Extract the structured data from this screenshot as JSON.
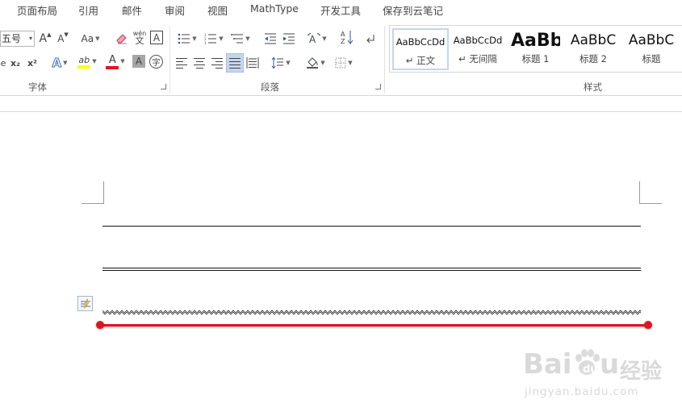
{
  "tabs": [
    "页面布局",
    "引用",
    "邮件",
    "审阅",
    "视图",
    "MathType",
    "开发工具",
    "保存到云笔记"
  ],
  "ribbon": {
    "font_group": {
      "label": "字体",
      "font_size": "五号",
      "grow_font": "A",
      "shrink_font": "A",
      "change_case": "Aa",
      "phonetic_top": "wén",
      "phonetic_bottom": "文",
      "border_char": "A",
      "subscript": "x₂",
      "superscript": "x²",
      "text_effect": "A",
      "highlight": "ab",
      "font_color": "A",
      "char_shading": "A",
      "enclose_char": "字"
    },
    "paragraph_group": {
      "label": "段落",
      "sort": "A\nZ"
    },
    "styles_group": {
      "label": "样式",
      "items": [
        {
          "sample": "AaBbCcDd",
          "name": "↵ 正文"
        },
        {
          "sample": "AaBbCcDd",
          "name": "↵ 无间隔"
        },
        {
          "sample": "AaBb",
          "name": "标题 1"
        },
        {
          "sample": "AaBbC",
          "name": "标题 2"
        },
        {
          "sample": "AaBbC",
          "name": "标题"
        }
      ]
    }
  },
  "colors": {
    "accent_red": "#e0141e",
    "highlight_yellow": "#ffff00",
    "font_red": "#e0141e",
    "selected_button": "#c5d5ee"
  },
  "watermark": {
    "brand": "Bai",
    "brand_end": "u",
    "service": "经验",
    "url": "jingyan.baidu.com"
  }
}
